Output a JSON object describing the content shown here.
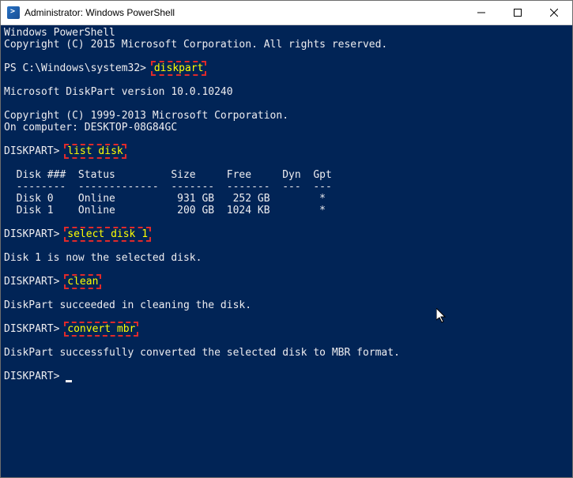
{
  "titlebar": {
    "title": "Administrator: Windows PowerShell"
  },
  "terminal": {
    "header": {
      "line1": "Windows PowerShell",
      "line2": "Copyright (C) 2015 Microsoft Corporation. All rights reserved."
    },
    "prompt1": {
      "ps": "PS C:\\Windows\\system32> ",
      "cmd": "diskpart"
    },
    "dp_header": {
      "version": "Microsoft DiskPart version 10.0.10240",
      "copyright": "Copyright (C) 1999-2013 Microsoft Corporation.",
      "computer": "On computer: DESKTOP-08G84GC"
    },
    "prompt2": {
      "dp": "DISKPART> ",
      "cmd": "list disk"
    },
    "table": {
      "header": "  Disk ###  Status         Size     Free     Dyn  Gpt",
      "sep": "  --------  -------------  -------  -------  ---  ---",
      "row0": "  Disk 0    Online          931 GB   252 GB        *",
      "row1": "  Disk 1    Online          200 GB  1024 KB        *"
    },
    "prompt3": {
      "dp": "DISKPART> ",
      "cmd": "select disk 1",
      "result": "Disk 1 is now the selected disk."
    },
    "prompt4": {
      "dp": "DISKPART> ",
      "cmd": "clean",
      "result": "DiskPart succeeded in cleaning the disk."
    },
    "prompt5": {
      "dp": "DISKPART> ",
      "cmd": "convert mbr",
      "result": "DiskPart successfully converted the selected disk to MBR format."
    },
    "prompt6": {
      "dp": "DISKPART> "
    }
  }
}
